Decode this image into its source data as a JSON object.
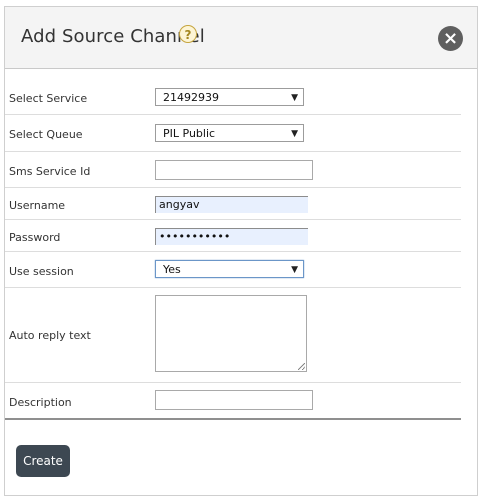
{
  "dialog": {
    "title": "Add Source Channel",
    "help_icon_glyph": "?",
    "close_icon_glyph": "×"
  },
  "form": {
    "select_service": {
      "label": "Select Service",
      "value": "21492939"
    },
    "select_queue": {
      "label": "Select Queue",
      "value": "PIL Public"
    },
    "sms_service_id": {
      "label": "Sms Service Id",
      "value": ""
    },
    "username": {
      "label": "Username",
      "value": "angyav"
    },
    "password": {
      "label": "Password",
      "value": "•••••••••••"
    },
    "use_session": {
      "label": "Use session",
      "value": "Yes"
    },
    "auto_reply_text": {
      "label": "Auto reply text",
      "value": ""
    },
    "description": {
      "label": "Description",
      "value": ""
    }
  },
  "actions": {
    "create_label": "Create"
  },
  "icons": {
    "help": "help-icon",
    "close": "close-icon",
    "dropdown": "chevron-down-icon"
  },
  "colors": {
    "header_bg": "#f4f4f4",
    "button_bg": "#3d4852",
    "close_bg": "#5f5f5f",
    "autofill_bg": "#e8f0fe",
    "focus_border": "#6b96c8"
  }
}
